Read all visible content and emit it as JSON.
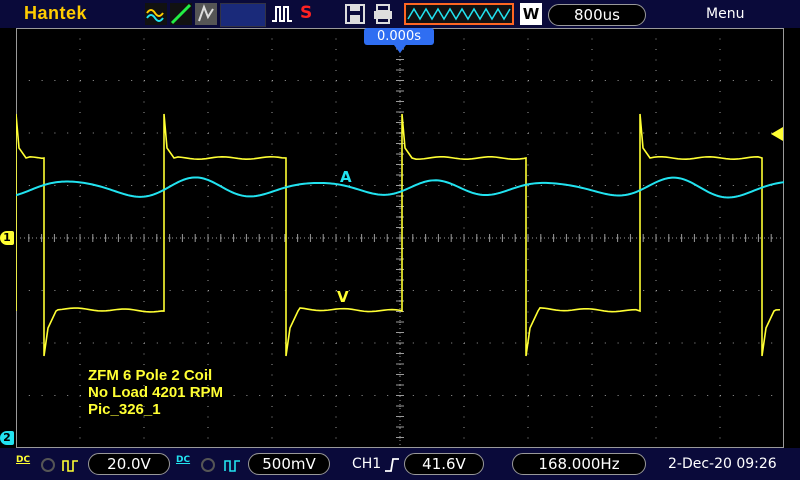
{
  "top": {
    "brand": "Hantek",
    "run_status": "S",
    "timebase": "800us",
    "acquire_mode": "W",
    "menu_label": "Menu"
  },
  "screen": {
    "trigger_time": "0.000s",
    "trace_label_current": "A",
    "trace_label_voltage": "V",
    "note_lines": [
      "ZFM 6 Pole 2 Coil",
      "No Load 4201 RPM",
      "Pic_326_1"
    ],
    "ch1_marker": "1",
    "ch2_marker": "2"
  },
  "bottom": {
    "ch1_coupling": "DC",
    "ch1_scale": "20.0V",
    "ch2_coupling": "DC",
    "ch2_scale": "500mV",
    "trigger_source": "CH1",
    "trigger_level": "41.6V",
    "frequency": "168.000Hz",
    "datetime": "2-Dec-20 09:26"
  },
  "colors": {
    "ch1": "#ffff33",
    "ch2": "#22e3f0",
    "grid": "#9a9a9a",
    "bar": "#0a0a3a",
    "accent": "#2f6ef2"
  },
  "icons": [
    "waveform-display-icon",
    "run-stop-icon",
    "save-icon",
    "print-icon",
    "trigger-edge-icon",
    "coupling-icon"
  ]
}
